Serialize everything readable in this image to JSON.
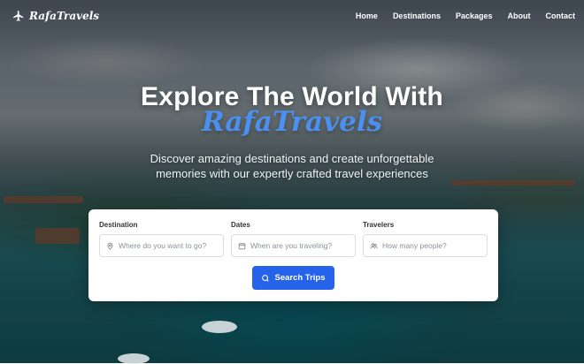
{
  "nav": {
    "brand": "RafaTravels",
    "logo_icon": "plane-icon",
    "links": [
      "Home",
      "Destinations",
      "Packages",
      "About",
      "Contact"
    ]
  },
  "hero": {
    "headline": "Explore The World With",
    "headline_brand": "RafaTravels",
    "subtitle_line1": "Discover amazing destinations and create unforgettable",
    "subtitle_line2": "memories with our expertly crafted travel experiences"
  },
  "search": {
    "destination": {
      "label": "Destination",
      "placeholder": "Where do you want to go?",
      "icon": "map-pin-icon"
    },
    "dates": {
      "label": "Dates",
      "placeholder": "When are you traveling?",
      "icon": "calendar-icon"
    },
    "travelers": {
      "label": "Travelers",
      "placeholder": "How many people?",
      "icon": "users-icon"
    },
    "button_label": "Search Trips",
    "button_icon": "search-icon"
  },
  "colors": {
    "accent": "#2563eb",
    "brand_highlight": "#4b8ff0"
  }
}
